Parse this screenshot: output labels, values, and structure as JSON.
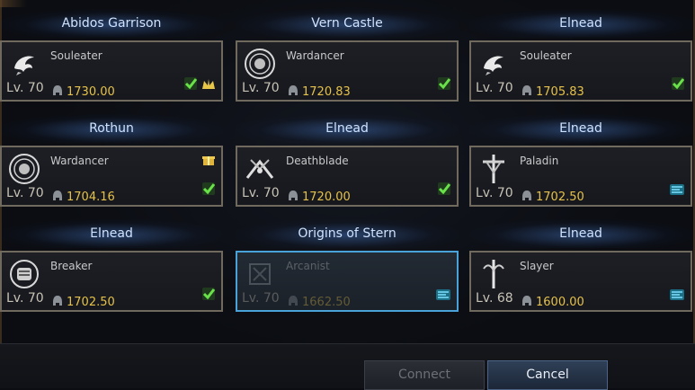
{
  "characters": [
    {
      "region": "Abidos Garrison",
      "class": "Souleater",
      "level": "Lv. 70",
      "item_level": "1730.00",
      "icon": "souleater-icon",
      "badges": [
        "checkmark-icon",
        "crown-icon"
      ],
      "top_badge": ""
    },
    {
      "region": "Vern Castle",
      "class": "Wardancer",
      "level": "Lv. 70",
      "item_level": "1720.83",
      "icon": "wardancer-icon",
      "badges": [
        "checkmark-icon"
      ],
      "top_badge": ""
    },
    {
      "region": "Elnead",
      "class": "Souleater",
      "level": "Lv. 70",
      "item_level": "1705.83",
      "icon": "souleater-icon",
      "badges": [
        "checkmark-icon"
      ],
      "top_badge": ""
    },
    {
      "region": "Rothun",
      "class": "Wardancer",
      "level": "Lv. 70",
      "item_level": "1704.16",
      "icon": "wardancer-icon",
      "badges": [
        "checkmark-icon"
      ],
      "top_badge": "gift-icon"
    },
    {
      "region": "Elnead",
      "class": "Deathblade",
      "level": "Lv. 70",
      "item_level": "1720.00",
      "icon": "deathblade-icon",
      "badges": [
        "checkmark-icon"
      ],
      "top_badge": ""
    },
    {
      "region": "Elnead",
      "class": "Paladin",
      "level": "Lv. 70",
      "item_level": "1702.50",
      "icon": "paladin-icon",
      "badges": [
        "reward-icon"
      ],
      "top_badge": ""
    },
    {
      "region": "Elnead",
      "class": "Breaker",
      "level": "Lv. 70",
      "item_level": "1702.50",
      "icon": "breaker-icon",
      "badges": [
        "checkmark-icon"
      ],
      "top_badge": ""
    },
    {
      "region": "Origins of Stern",
      "class": "Arcanist",
      "level": "Lv. 70",
      "item_level": "1662.50",
      "icon": "arcanist-icon",
      "badges": [
        "reward-icon"
      ],
      "top_badge": "",
      "selected": true
    },
    {
      "region": "Elnead",
      "class": "Slayer",
      "level": "Lv. 68",
      "item_level": "1600.00",
      "icon": "slayer-icon",
      "badges": [
        "reward-icon"
      ],
      "top_badge": ""
    }
  ],
  "buttons": {
    "connect": "Connect",
    "cancel": "Cancel"
  },
  "colors": {
    "gold": "#e6c24a",
    "region_text": "#cfe3ff",
    "border": "#6f6a5d",
    "selected_border": "#4aa3d8"
  }
}
